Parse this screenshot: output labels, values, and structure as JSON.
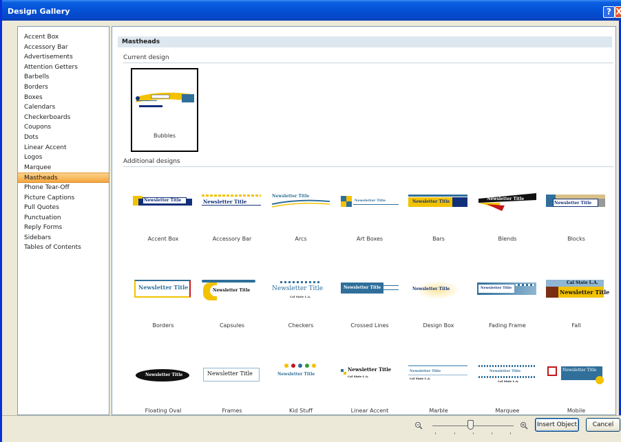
{
  "window": {
    "title": "Design Gallery",
    "help_glyph": "?",
    "close_glyph": "X"
  },
  "categories": [
    "Accent Box",
    "Accessory Bar",
    "Advertisements",
    "Attention Getters",
    "Barbells",
    "Borders",
    "Boxes",
    "Calendars",
    "Checkerboards",
    "Coupons",
    "Dots",
    "Linear Accent",
    "Logos",
    "Marquee",
    "Mastheads",
    "Phone Tear-Off",
    "Picture Captions",
    "Pull Quotes",
    "Punctuation",
    "Reply Forms",
    "Sidebars",
    "Tables of Contents"
  ],
  "selected_category": "Mastheads",
  "main": {
    "section_title": "Mastheads",
    "current_label": "Current design",
    "additional_label": "Additional designs",
    "current_design": "Bubbles"
  },
  "designs": [
    "Accent Box",
    "Accessory Bar",
    "Arcs",
    "Art Boxes",
    "Bars",
    "Blends",
    "Blocks",
    "Borders",
    "Capsules",
    "Checkers",
    "Crossed Lines",
    "Design Box",
    "Fading Frame",
    "Fall",
    "Floating Oval",
    "Frames",
    "Kid Stuff",
    "Linear Accent",
    "Marble",
    "Marquee",
    "Mobile"
  ],
  "thumb_text": {
    "title": "Newsletter Title",
    "org": "Cal State L.A."
  },
  "buttons": {
    "insert": "Insert Object",
    "cancel": "Cancel"
  },
  "zoom_icons": {
    "out": "zoom-out-icon",
    "in": "zoom-in-icon"
  },
  "colors": {
    "title_bar": "#0451d6",
    "selected": "#f4a640",
    "navy": "#12307a",
    "gold": "#f2c200",
    "teal": "#2f6f9a"
  }
}
